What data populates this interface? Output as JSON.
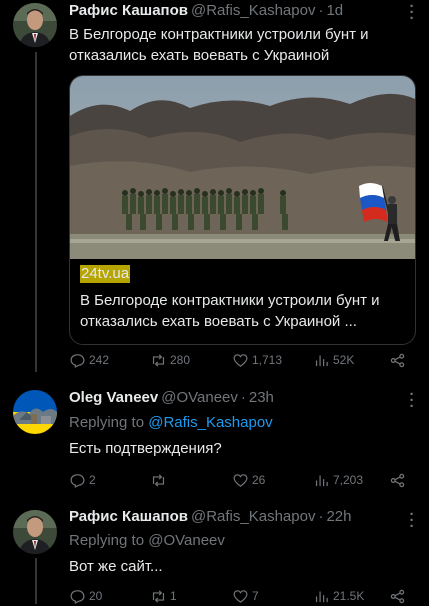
{
  "tweets": [
    {
      "name": "Рафис Кашапов",
      "handle": "@Rafis_Kashapov",
      "time": "1d",
      "text": "В Белгороде контрактники устроили бунт и отказались ехать воевать с Украиной",
      "card": {
        "domain": "24tv.ua",
        "title": "В Белгороде контрактники устроили бунт и отказались ехать воевать с Украиной ..."
      },
      "actions": {
        "replies": "242",
        "retweets": "280",
        "likes": "1,713",
        "views": "52K"
      }
    },
    {
      "name": "Oleg Vaneev",
      "handle": "@OVaneev",
      "time": "23h",
      "replying_prefix": "Replying to ",
      "replying_to": "@Rafis_Kashapov",
      "text": "Есть подтверждения?",
      "actions": {
        "replies": "2",
        "retweets": "",
        "likes": "26",
        "views": "7,203"
      }
    },
    {
      "name": "Рафис Кашапов",
      "handle": "@Rafis_Kashapov",
      "time": "22h",
      "replying_prefix": "Replying to ",
      "replying_to": "@OVaneev",
      "text": "Вот же сайт...",
      "actions": {
        "replies": "20",
        "retweets": "1",
        "likes": "7",
        "views": "21.5K"
      }
    }
  ],
  "separator": "·",
  "colors": {
    "accent": "#1d9bf0",
    "muted": "#71767b",
    "text": "#e7e9ea",
    "background": "#000000"
  }
}
